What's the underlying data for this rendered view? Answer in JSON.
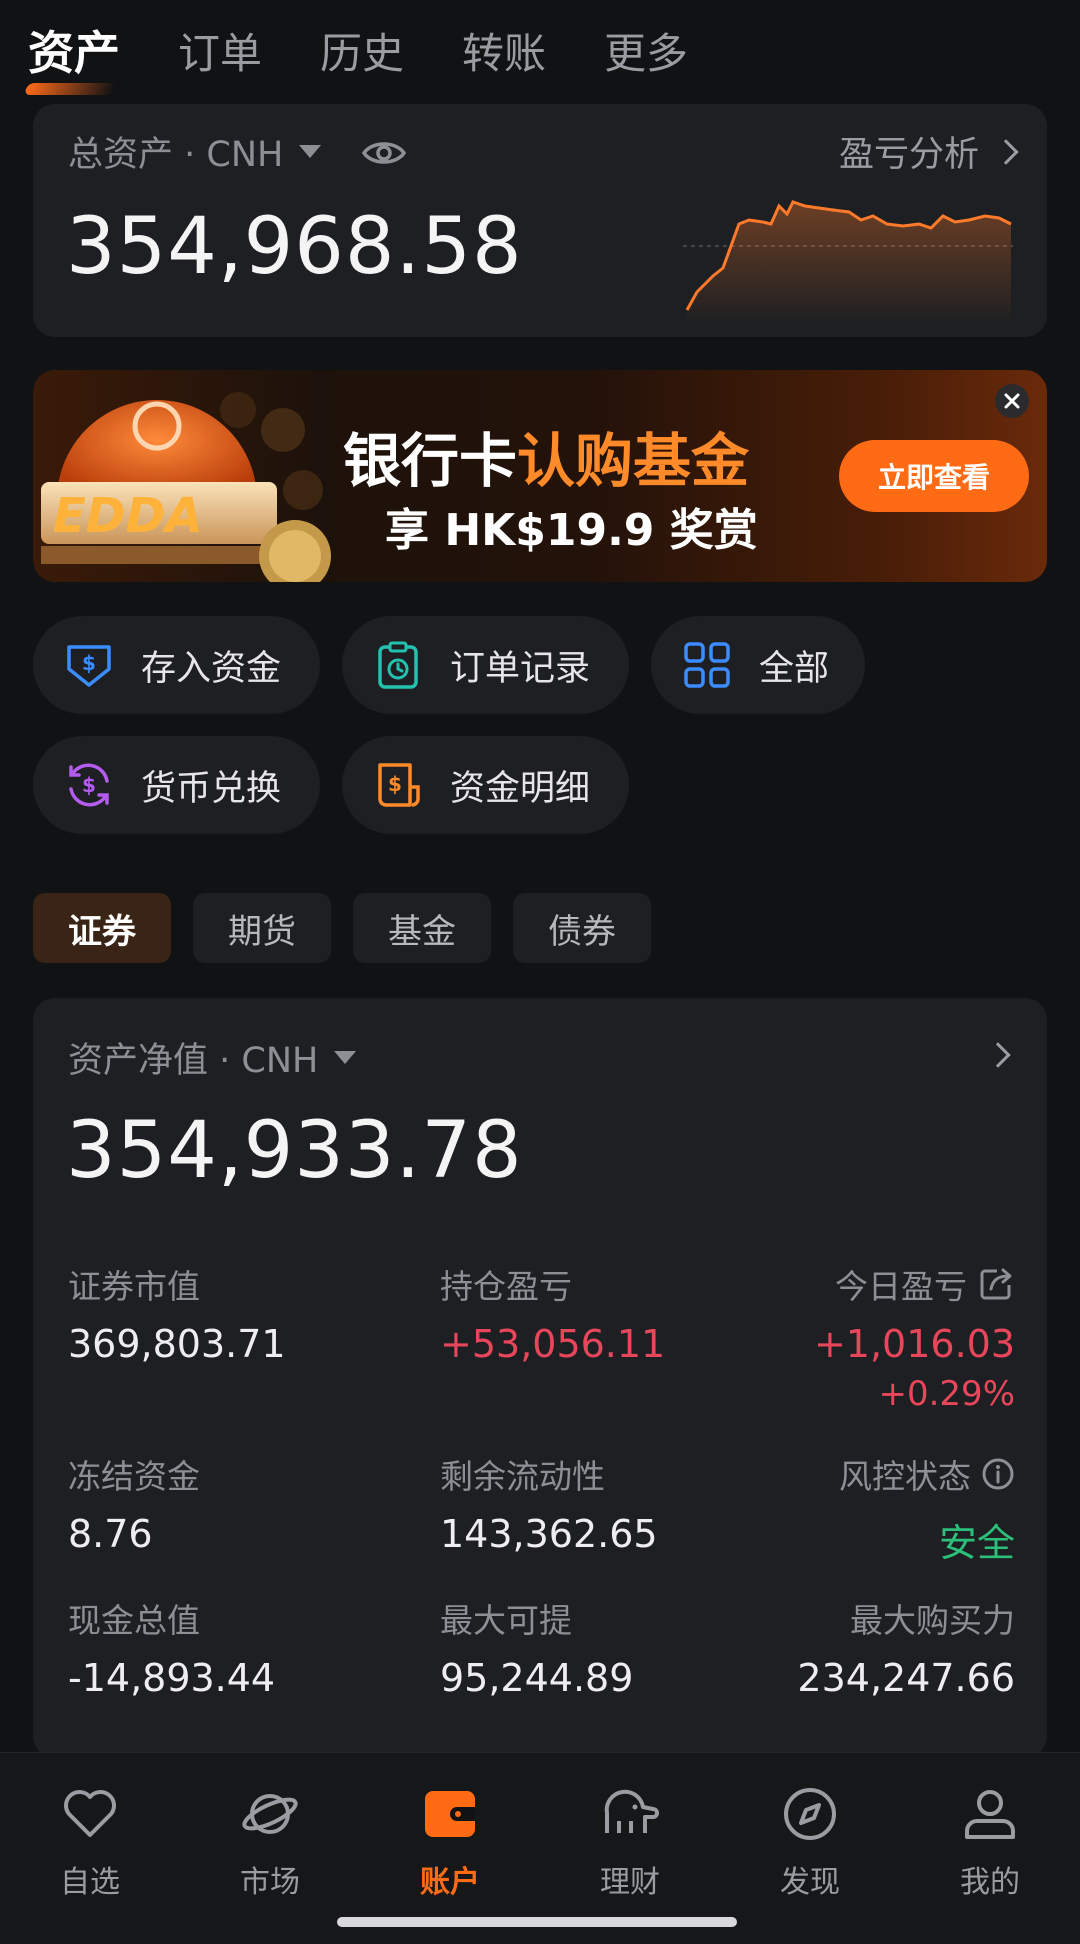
{
  "top_tabs": [
    {
      "label": "资产",
      "active": true
    },
    {
      "label": "订单"
    },
    {
      "label": "历史"
    },
    {
      "label": "转账"
    },
    {
      "label": "更多"
    }
  ],
  "assets": {
    "label": "总资产 · CNH",
    "pnl_link": "盈亏分析",
    "value": "354,968.58"
  },
  "banner": {
    "title_part1": "银行卡",
    "title_part2": "认购基金",
    "subtitle": "享 HK$19.9 奖赏",
    "button": "立即查看",
    "logo_text": "EDDA"
  },
  "quick_actions": [
    {
      "label": "存入资金",
      "icon": "deposit-icon"
    },
    {
      "label": "订单记录",
      "icon": "order-record-icon"
    },
    {
      "label": "全部",
      "icon": "grid-icon"
    },
    {
      "label": "货币兑换",
      "icon": "currency-exchange-icon"
    },
    {
      "label": "资金明细",
      "icon": "fund-detail-icon"
    }
  ],
  "segments": [
    {
      "label": "证券",
      "active": true
    },
    {
      "label": "期货"
    },
    {
      "label": "基金"
    },
    {
      "label": "债券"
    }
  ],
  "net_value": {
    "label": "资产净值 · CNH",
    "value": "354,933.78"
  },
  "metrics": {
    "securities_value": {
      "label": "证券市值",
      "value": "369,803.71"
    },
    "position_pnl": {
      "label": "持仓盈亏",
      "value": "+53,056.11"
    },
    "today_pnl": {
      "label": "今日盈亏",
      "value": "+1,016.03",
      "pct": "+0.29%"
    },
    "frozen": {
      "label": "冻结资金",
      "value": "8.76"
    },
    "liquidity": {
      "label": "剩余流动性",
      "value": "143,362.65"
    },
    "risk": {
      "label": "风控状态",
      "value": "安全"
    },
    "cash": {
      "label": "现金总值",
      "value": "-14,893.44"
    },
    "max_withdraw": {
      "label": "最大可提",
      "value": "95,244.89"
    },
    "max_buying": {
      "label": "最大购买力",
      "value": "234,247.66"
    }
  },
  "bottom_nav": [
    {
      "label": "自选",
      "icon": "heart-icon"
    },
    {
      "label": "市场",
      "icon": "planet-icon"
    },
    {
      "label": "账户",
      "icon": "wallet-icon",
      "active": true
    },
    {
      "label": "理财",
      "icon": "elephant-icon"
    },
    {
      "label": "发现",
      "icon": "compass-icon"
    },
    {
      "label": "我的",
      "icon": "profile-icon"
    }
  ],
  "colors": {
    "accent": "#ff6a14",
    "up": "#e8465a",
    "safe": "#2bbf7a",
    "background": "#111214",
    "card": "#1e1f22"
  }
}
